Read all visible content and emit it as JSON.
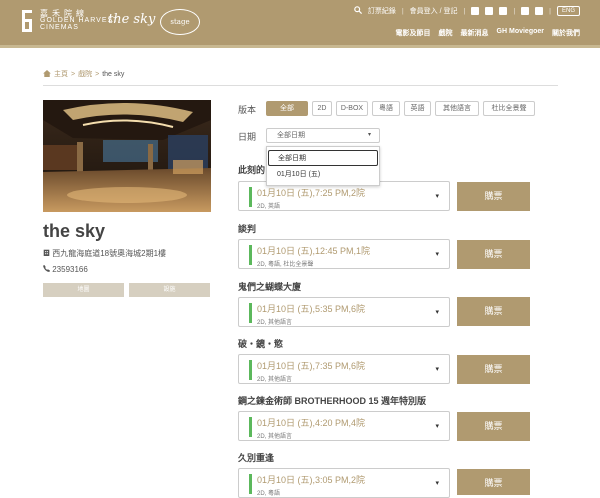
{
  "header": {
    "brand_zh": "嘉禾院線",
    "brand_en1": "GOLDEN HARVEST",
    "brand_en2": "CINEMAS",
    "sky_logo": "the sky",
    "stage_logo": "stage",
    "top_links": [
      "訂票紀錄",
      "會員登入 / 登記"
    ],
    "eng_label": "ENG",
    "nav": [
      "電影及節目",
      "戲院",
      "最新消息",
      "GH Moviegoer",
      "關於我們"
    ]
  },
  "breadcrumb": {
    "home": "主頁",
    "sep": ">",
    "cinemas": "戲院",
    "current": "the sky"
  },
  "cinema": {
    "name": "the sky",
    "address": "西九龍海庭道18號奧海城2期1樓",
    "phone": "23593166",
    "map_label": "地圖",
    "transport_label": "設施"
  },
  "filters": {
    "version_label": "版本",
    "formats": [
      "全部",
      "2D",
      "D-BOX",
      "粵語",
      "英語",
      "其他語言",
      "杜比全景聲"
    ],
    "date_label": "日期",
    "date_selected": "全部日期",
    "date_options": [
      "全部日期",
      "01月10日 (五)"
    ]
  },
  "buy_label": "購票",
  "movies": [
    {
      "title": "此刻的",
      "time": "01月10日 (五),7:25 PM,2院",
      "sub": "2D, 英語"
    },
    {
      "title": "談判",
      "time": "01月10日 (五),12:45 PM,1院",
      "sub": "2D, 粵語, 杜比全景聲"
    },
    {
      "title": "鬼們之蝴蝶大廈",
      "time": "01月10日 (五),5:35 PM,6院",
      "sub": "2D, 其他語言"
    },
    {
      "title": "破・鏡・慾",
      "time": "01月10日 (五),7:35 PM,6院",
      "sub": "2D, 其他語言"
    },
    {
      "title": "鋼之鍊金術師 BROTHERHOOD 15 週年特別版",
      "time": "01月10日 (五),4:20 PM,4院",
      "sub": "2D, 其他語言"
    },
    {
      "title": "久別重逢",
      "time": "01月10日 (五),3:05 PM,2院",
      "sub": "2D, 粵語"
    }
  ],
  "colors": {
    "brand": "#b09a70",
    "accent_bar": "#5cb85c"
  }
}
